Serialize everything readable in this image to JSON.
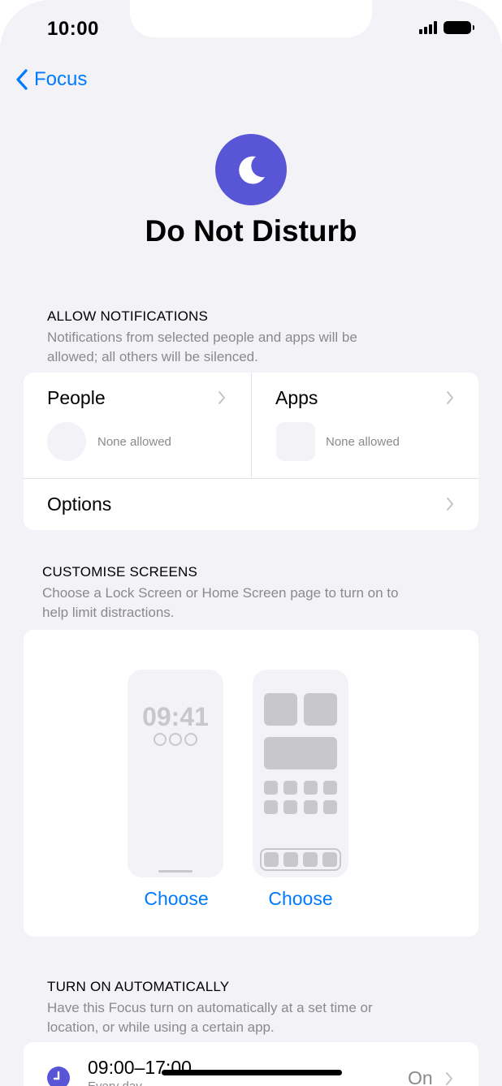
{
  "status_bar": {
    "time": "10:00"
  },
  "nav": {
    "back_label": "Focus"
  },
  "hero": {
    "title": "Do Not Disturb",
    "icon": "moon-icon",
    "accent": "#5856d6"
  },
  "allow_notifications": {
    "header": "ALLOW NOTIFICATIONS",
    "description_line1": "Notifications from selected people and apps will be",
    "description_line2": "allowed; all others will be silenced.",
    "people": {
      "label": "People",
      "status": "None allowed"
    },
    "apps": {
      "label": "Apps",
      "status": "None allowed"
    },
    "options": {
      "label": "Options"
    }
  },
  "customise_screens": {
    "header": "CUSTOMISE SCREENS",
    "description_line1": "Choose a Lock Screen or Home Screen page to turn on to",
    "description_line2": "help limit distractions.",
    "lock_screen": {
      "time": "09:41",
      "choose_label": "Choose"
    },
    "home_screen": {
      "choose_label": "Choose"
    }
  },
  "turn_on_automatically": {
    "header": "TURN ON AUTOMATICALLY",
    "description_line1": "Have this Focus turn on automatically at a set time or",
    "description_line2": "location, or while using a certain app.",
    "schedule": {
      "time_range": "09:00–17:00",
      "subtitle": "Every day",
      "status": "On"
    }
  },
  "colors": {
    "link": "#007aff",
    "background": "#f2f2f7",
    "secondary_text": "#8a8a8e"
  }
}
